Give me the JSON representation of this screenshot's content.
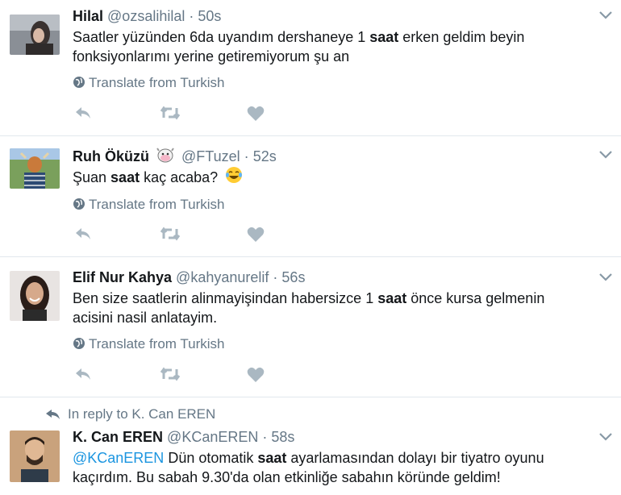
{
  "tweets": [
    {
      "name": "Hilal",
      "handle": "@ozsalihilal",
      "sep": "·",
      "time": "50s",
      "line1_pre": "Saatler yüzünden 6da uyandım dershaneye 1 ",
      "line1_bold": "saat",
      "line1_post": " erken geldim beyin",
      "line2": "fonksiyonlarımı yerine getiremiyorum şu an",
      "translate": "Translate from Turkish"
    },
    {
      "name": "Ruh Öküzü",
      "handle": "@FTuzel",
      "sep": "·",
      "time": "52s",
      "line1_pre": "Şuan ",
      "line1_bold": "saat",
      "line1_post": " kaç acaba?",
      "translate": "Translate from Turkish"
    },
    {
      "name": "Elif Nur Kahya",
      "handle": "@kahyanurelif",
      "sep": "·",
      "time": "56s",
      "line1_pre": "Ben size saatlerin alinmayişindan habersizce 1 ",
      "line1_bold": "saat",
      "line1_post": " önce kursa gelmenin",
      "line2": "acisini nasil anlatayim.",
      "translate": "Translate from Turkish"
    },
    {
      "name": "K. Can EREN",
      "handle": "@KCanEREN",
      "sep": "·",
      "time": "58s",
      "in_reply": "In reply to K. Can EREN",
      "line1_mention": "@KCanEREN",
      "line1_pre": " Dün otomatik ",
      "line1_bold": "saat",
      "line1_post": " ayarlamasından dolayı bir tiyatro oyunu",
      "line2": "kaçırdım. Bu sabah 9.30'da olan etkinliğe sabahın köründe geldim!"
    }
  ],
  "colors": {
    "muted": "#657786",
    "link": "#1b95e0",
    "border": "#e1e8ed",
    "icon": "#aab8c2"
  },
  "icons": [
    "reply-icon",
    "retweet-icon",
    "like-icon",
    "globe-icon",
    "chevron-down-icon",
    "cow-emoji-icon",
    "laughing-emoji-icon"
  ]
}
